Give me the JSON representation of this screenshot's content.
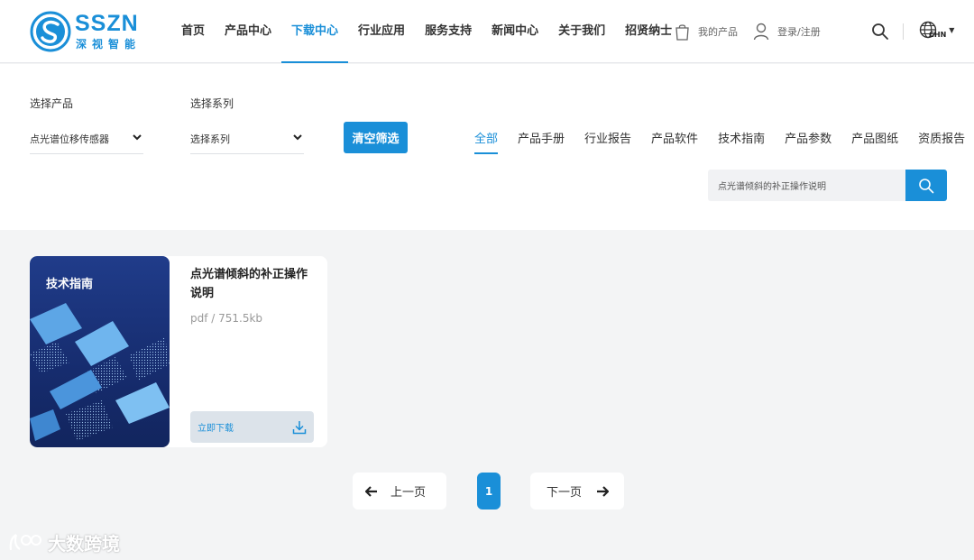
{
  "brand": {
    "name": "SSZN",
    "subtitle": "深视智能",
    "color": "#1a8fd8"
  },
  "nav": {
    "items": [
      {
        "label": "首页"
      },
      {
        "label": "产品中心"
      },
      {
        "label": "下载中心",
        "active": true
      },
      {
        "label": "行业应用"
      },
      {
        "label": "服务支持"
      },
      {
        "label": "新闻中心"
      },
      {
        "label": "关于我们"
      },
      {
        "label": "招贤纳士"
      }
    ],
    "my_products": "我的产品",
    "login": "登录/注册",
    "language": "CHN"
  },
  "filter": {
    "product_label": "选择产品",
    "product_value": "点光谱位移传感器",
    "series_label": "选择系列",
    "series_value": "选择系列",
    "clear_button": "清空筛选",
    "tabs": [
      {
        "label": "全部",
        "active": true
      },
      {
        "label": "产品手册"
      },
      {
        "label": "行业报告"
      },
      {
        "label": "产品软件"
      },
      {
        "label": "技术指南"
      },
      {
        "label": "产品参数"
      },
      {
        "label": "产品图纸"
      },
      {
        "label": "资质报告"
      }
    ],
    "search_value": "点光谱倾斜的补正操作说明"
  },
  "documents": [
    {
      "cover_label": "技术指南",
      "title": "点光谱倾斜的补正操作说明",
      "meta": "pdf / 751.5kb",
      "download_label": "立即下载"
    }
  ],
  "pagination": {
    "prev_label": "上一页",
    "current_page": "1",
    "next_label": "下一页"
  },
  "watermark": "大数跨境"
}
